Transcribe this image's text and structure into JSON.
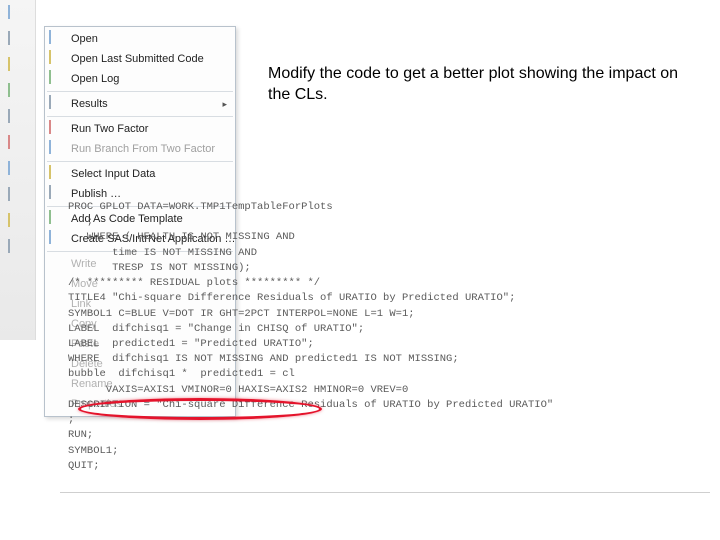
{
  "annotation": "Modify the code to get a better plot showing the impact on the CLs.",
  "menu": {
    "items": [
      {
        "label": "Open",
        "icon": "open-icon",
        "enabled": true,
        "submenu": false
      },
      {
        "label": "Open Last Submitted Code",
        "icon": "open-last-icon",
        "enabled": true,
        "submenu": false
      },
      {
        "label": "Open Log",
        "icon": "log-icon",
        "enabled": true,
        "submenu": false
      },
      {
        "sep": true
      },
      {
        "label": "Results",
        "icon": "results-icon",
        "enabled": true,
        "submenu": true
      },
      {
        "sep": true
      },
      {
        "label": "Run Two Factor",
        "icon": "run-icon",
        "enabled": true,
        "submenu": false
      },
      {
        "label": "Run Branch From Two Factor",
        "icon": "run-branch-icon",
        "enabled": false,
        "submenu": false
      },
      {
        "sep": true
      },
      {
        "label": "Select Input Data",
        "icon": "select-data-icon",
        "enabled": true,
        "submenu": false
      },
      {
        "label": "Publish …",
        "icon": "publish-icon",
        "enabled": true,
        "submenu": false
      },
      {
        "sep": true
      },
      {
        "label": "Add As Code Template",
        "icon": "template-icon",
        "enabled": true,
        "submenu": false
      },
      {
        "label": "Create SAS/IntrNet Application …",
        "icon": "intrnet-icon",
        "enabled": true,
        "submenu": false
      }
    ],
    "truncated": [
      {
        "label": "Write"
      },
      {
        "label": "Move"
      },
      {
        "label": "Link"
      },
      {
        "label": "Copy"
      },
      {
        "label": "Paste"
      },
      {
        "label": "Delete"
      },
      {
        "label": "Rename"
      },
      {
        "label": "Properties"
      }
    ]
  },
  "code": [
    "PROC GPLOT DATA=WORK.TMP1TempTableForPlots",
    "   ;",
    "   WHERE ( HEALTH IS NOT MISSING AND",
    "       time IS NOT MISSING AND",
    "       TRESP IS NOT MISSING);",
    "",
    "/* ********* RESIDUAL plots ********* */",
    "",
    "TITLE4 \"Chi-square Difference Residuals of URATIO by Predicted URATIO\";",
    "SYMBOL1 C=BLUE V=DOT IR GHT=2PCT INTERPOL=NONE L=1 W=1;",
    "LABEL  difchisq1 = \"Change in CHISQ of URATIO\";",
    "LABEL  predicted1 = \"Predicted URATIO\";",
    "WHERE  difchisq1 IS NOT MISSING AND predicted1 IS NOT MISSING;",
    "bubble  difchisq1 *  predicted1 = cl",
    "      VAXIS=AXIS1 VMINOR=0 HAXIS=AXIS2 HMINOR=0 VREV=0",
    "DESCRIPTION = \"Chi-square Difference Residuals of URATIO by Predicted URATIO\"",
    ";",
    "RUN;",
    "",
    "SYMBOL1;",
    "QUIT;"
  ]
}
